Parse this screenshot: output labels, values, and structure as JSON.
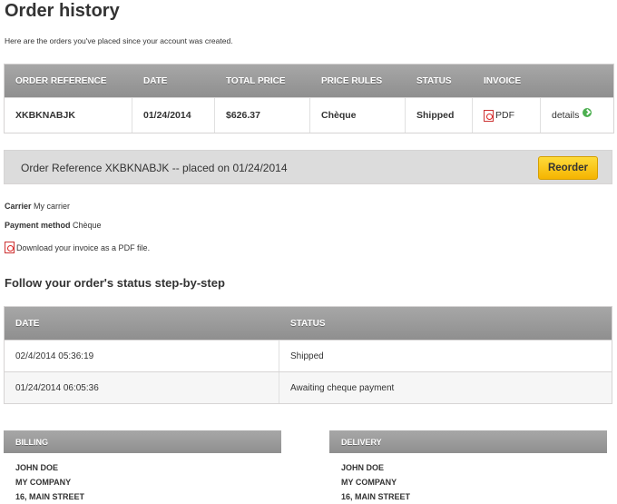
{
  "page": {
    "title": "Order history",
    "intro": "Here are the orders you've placed since your account was created."
  },
  "orders_table": {
    "headers": [
      "ORDER REFERENCE",
      "DATE",
      "TOTAL PRICE",
      "PRICE RULES",
      "STATUS",
      "INVOICE",
      ""
    ],
    "rows": [
      {
        "reference": "XKBKNABJK",
        "date": "01/24/2014",
        "total": "$626.37",
        "price_rules": "Chèque",
        "status": "Shipped",
        "invoice": "PDF",
        "details": "details"
      }
    ]
  },
  "order_bar": {
    "label": "Order Reference XKBKNABJK -- placed on 01/24/2014",
    "reorder_label": "Reorder"
  },
  "info": {
    "carrier_label": "Carrier",
    "carrier_value": "My carrier",
    "payment_label": "Payment method",
    "payment_value": "Chèque",
    "pdf_link": "Download your invoice as a PDF file."
  },
  "status_section": {
    "title": "Follow your order's status step-by-step",
    "headers": [
      "DATE",
      "STATUS"
    ],
    "rows": [
      {
        "date": "02/4/2014 05:36:19",
        "status": "Shipped"
      },
      {
        "date": "01/24/2014 06:05:36",
        "status": "Awaiting cheque payment"
      }
    ]
  },
  "billing": {
    "title": "BILLING",
    "lines": [
      "JOHN DOE",
      "MY COMPANY",
      "16, MAIN STREET"
    ]
  },
  "delivery": {
    "title": "DELIVERY",
    "lines": [
      "JOHN DOE",
      "MY COMPANY",
      "16, MAIN STREET"
    ]
  }
}
